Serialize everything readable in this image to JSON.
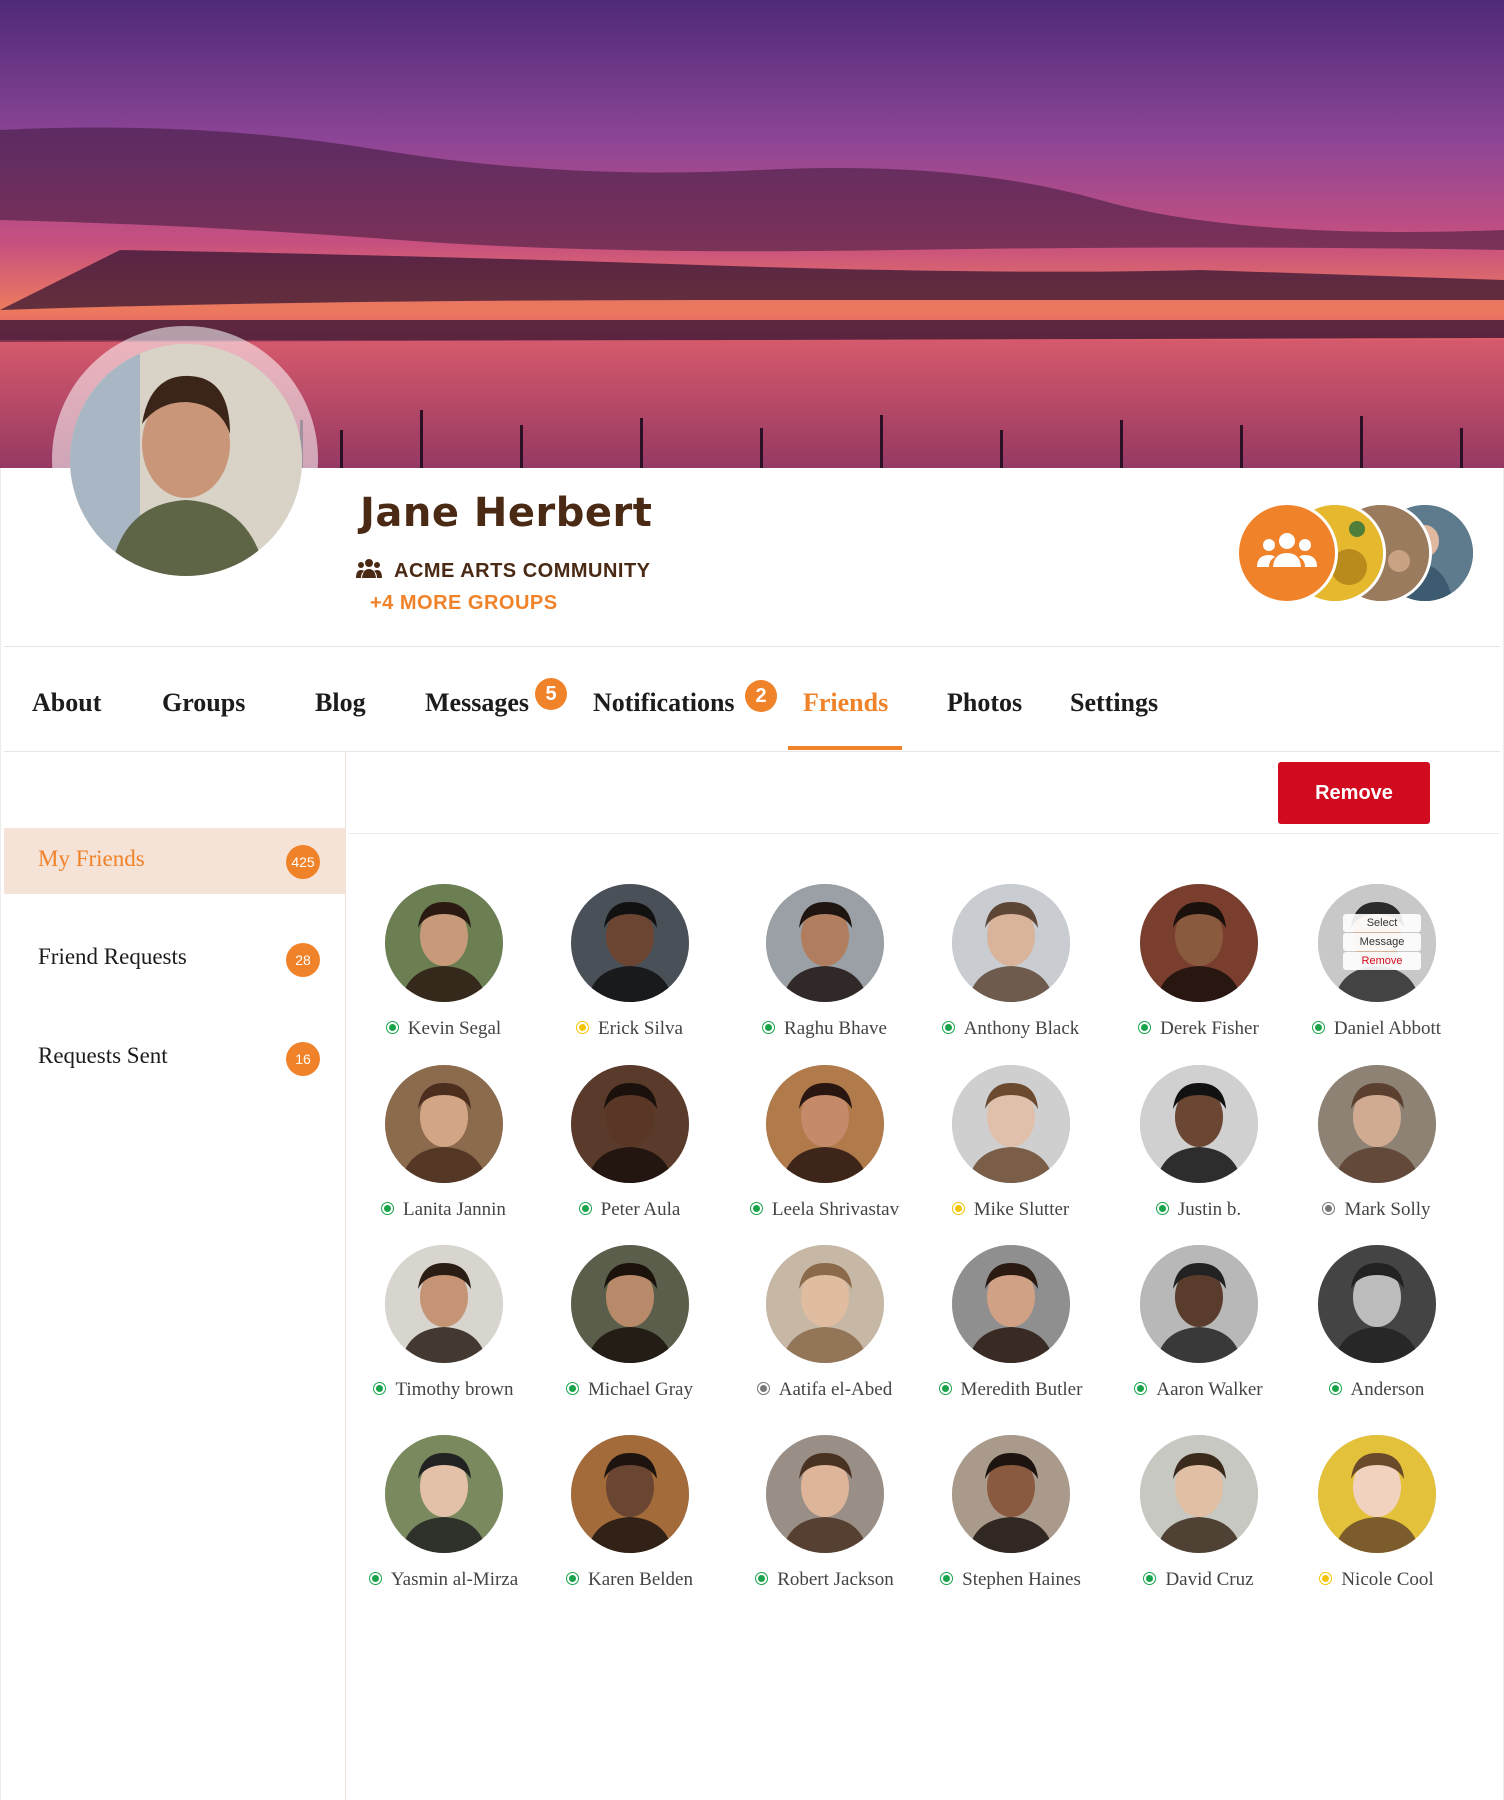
{
  "profile": {
    "name": "Jane Herbert",
    "primary_group": "ACME ARTS COMMUNITY",
    "more_groups": "+4 MORE GROUPS"
  },
  "tabs": [
    {
      "label": "About"
    },
    {
      "label": "Groups"
    },
    {
      "label": "Blog"
    },
    {
      "label": "Messages",
      "badge": "5"
    },
    {
      "label": "Notifications",
      "badge": "2"
    },
    {
      "label": "Friends",
      "active": true
    },
    {
      "label": "Photos"
    },
    {
      "label": "Settings"
    }
  ],
  "sidebar": {
    "items": [
      {
        "label": "My Friends",
        "count": "425",
        "active": true
      },
      {
        "label": "Friend Requests",
        "count": "28"
      },
      {
        "label": "Requests Sent",
        "count": "16"
      }
    ]
  },
  "toolbar": {
    "remove_label": "Remove"
  },
  "context_menu": {
    "items": [
      "Select",
      "Message",
      "Remove"
    ]
  },
  "colors": {
    "accent": "#f0822a",
    "danger": "#d10a1f",
    "online": "#1aa34a",
    "away": "#f5c400",
    "offline": "#777777",
    "name": "#4a2a14"
  },
  "icons": {
    "group": "users-icon"
  },
  "friends": [
    {
      "name": "Kevin Segal",
      "status": "online"
    },
    {
      "name": "Erick Silva",
      "status": "away"
    },
    {
      "name": "Raghu Bhave",
      "status": "online"
    },
    {
      "name": "Anthony Black",
      "status": "online"
    },
    {
      "name": "Derek Fisher",
      "status": "online"
    },
    {
      "name": "Daniel Abbott",
      "status": "online"
    },
    {
      "name": "Lanita Jannin",
      "status": "online"
    },
    {
      "name": "Peter Aula",
      "status": "online"
    },
    {
      "name": "Leela Shrivastav",
      "status": "online"
    },
    {
      "name": "Mike Slutter",
      "status": "away"
    },
    {
      "name": "Justin b.",
      "status": "online"
    },
    {
      "name": "Mark Solly",
      "status": "offline"
    },
    {
      "name": "Timothy brown",
      "status": "online"
    },
    {
      "name": "Michael Gray",
      "status": "online"
    },
    {
      "name": "Aatifa el-Abed",
      "status": "offline"
    },
    {
      "name": "Meredith Butler",
      "status": "online"
    },
    {
      "name": "Aaron Walker",
      "status": "online"
    },
    {
      "name": "Anderson",
      "status": "online"
    },
    {
      "name": "Yasmin al-Mirza",
      "status": "online"
    },
    {
      "name": "Karen Belden",
      "status": "online"
    },
    {
      "name": "Robert Jackson",
      "status": "online"
    },
    {
      "name": "Stephen Haines",
      "status": "online"
    },
    {
      "name": "David Cruz",
      "status": "online"
    },
    {
      "name": "Nicole Cool",
      "status": "away"
    }
  ]
}
